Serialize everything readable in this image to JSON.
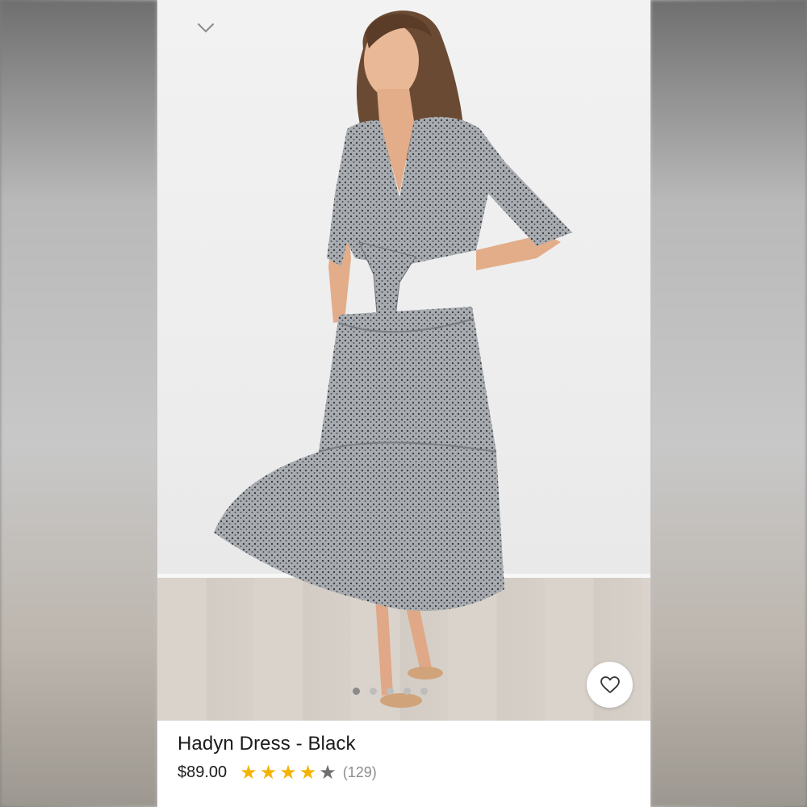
{
  "product": {
    "title": "Hadyn Dress - Black",
    "price": "$89.00",
    "rating": 4,
    "rating_max": 5,
    "review_count": "(129)"
  },
  "gallery": {
    "image_count": 5,
    "active_index": 0
  },
  "icons": {
    "collapse": "chevron-down-icon",
    "favorite": "heart-icon"
  },
  "colors": {
    "star_filled": "#f5b301",
    "star_empty": "#6f6f6f",
    "dress_fabric": "#8e9296"
  }
}
